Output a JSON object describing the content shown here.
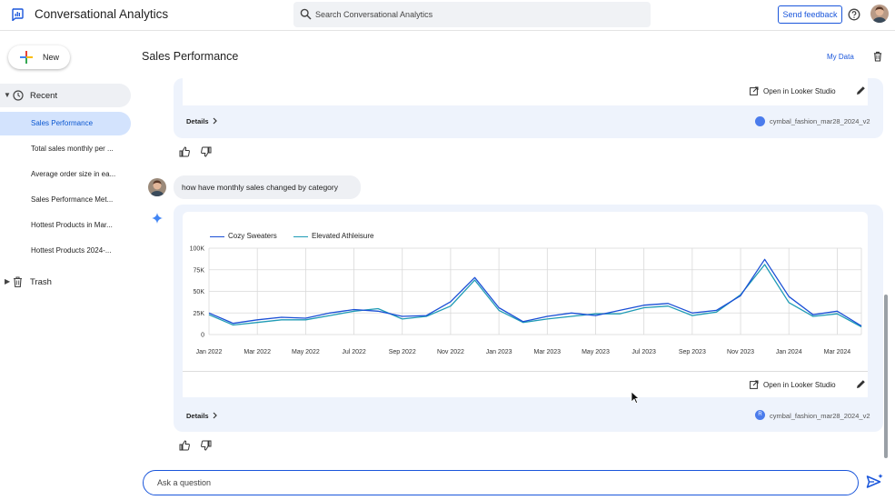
{
  "app": {
    "title": "Conversational Analytics"
  },
  "search": {
    "placeholder": "Search Conversational Analytics"
  },
  "header": {
    "feedback_label": "Send feedback"
  },
  "sidebar": {
    "new_label": "New",
    "recent_label": "Recent",
    "items": [
      {
        "label": "Sales Performance",
        "active": true
      },
      {
        "label": "Total sales monthly per ..."
      },
      {
        "label": "Average order size in ea..."
      },
      {
        "label": "Sales Performance Met..."
      },
      {
        "label": "Hottest Products in Mar..."
      },
      {
        "label": "Hottest Products 2024-..."
      }
    ],
    "trash_label": "Trash"
  },
  "main": {
    "page_title": "Sales Performance",
    "my_data_label": "My Data"
  },
  "previous_card": {
    "looker_label": "Open in Looker Studio",
    "details_label": "Details",
    "datasource": "cymbal_fashion_mar28_2024_v2"
  },
  "user_message": "how have monthly sales changed by category",
  "current_card": {
    "looker_label": "Open in Looker Studio",
    "details_label": "Details",
    "datasource": "cymbal_fashion_mar28_2024_v2",
    "datasource_badge": "R"
  },
  "ask": {
    "placeholder": "Ask a question"
  },
  "colors": {
    "accent": "#1a56db",
    "series1": "#1a4fd6",
    "series2": "#1f9bb5",
    "card_bg": "#eef3fc"
  },
  "chart_data": {
    "type": "line",
    "x": [
      "Jan 2022",
      "Feb 2022",
      "Mar 2022",
      "Apr 2022",
      "May 2022",
      "Jun 2022",
      "Jul 2022",
      "Aug 2022",
      "Sep 2022",
      "Oct 2022",
      "Nov 2022",
      "Dec 2022",
      "Jan 2023",
      "Feb 2023",
      "Mar 2023",
      "Apr 2023",
      "May 2023",
      "Jun 2023",
      "Jul 2023",
      "Aug 2023",
      "Sep 2023",
      "Oct 2023",
      "Nov 2023",
      "Dec 2023",
      "Jan 2024",
      "Feb 2024",
      "Mar 2024",
      "Apr 2024"
    ],
    "x_tick_labels": [
      "Jan 2022",
      "Mar 2022",
      "May 2022",
      "Jul 2022",
      "Sep 2022",
      "Nov 2022",
      "Jan 2023",
      "Mar 2023",
      "May 2023",
      "Jul 2023",
      "Sep 2023",
      "Nov 2023",
      "Jan 2024",
      "Mar 2024"
    ],
    "series": [
      {
        "name": "Cozy Sweaters",
        "values": [
          25000,
          13000,
          17000,
          20000,
          19000,
          25000,
          29000,
          27000,
          21000,
          22000,
          38000,
          66000,
          31000,
          15000,
          21000,
          25000,
          22000,
          28000,
          34000,
          36000,
          25000,
          28000,
          45000,
          87000,
          44000,
          23000,
          27000,
          10000
        ]
      },
      {
        "name": "Elevated Athleisure",
        "values": [
          23000,
          11000,
          14000,
          17000,
          17000,
          22000,
          27000,
          30000,
          18000,
          21000,
          33000,
          63000,
          28000,
          14000,
          18000,
          21000,
          24000,
          24000,
          31000,
          33000,
          22000,
          26000,
          46000,
          81000,
          37000,
          21000,
          24000,
          9000
        ]
      }
    ],
    "ylim": [
      0,
      100000
    ],
    "y_ticks": [
      0,
      25000,
      50000,
      75000,
      100000
    ],
    "y_tick_labels": [
      "0",
      "25K",
      "50K",
      "75K",
      "100K"
    ],
    "legend_position": "top-left",
    "grid": true
  }
}
